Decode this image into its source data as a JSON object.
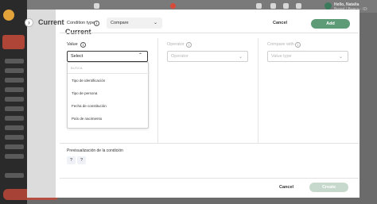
{
  "topbar": {
    "user_greeting": "Hello, Natalia",
    "user_sub": "Brand / Banco - ID: 2020/00123"
  },
  "page": {
    "title": "Current"
  },
  "condition": {
    "type_label": "Condition type",
    "type_value": "Compare",
    "cancel_label": "Cancel",
    "add_label": "Add"
  },
  "value_col": {
    "label": "Value",
    "placeholder": "Select",
    "search_placeholder": "BUSCA",
    "options": [
      "Tipo de identificación",
      "Tipo de persona",
      "Fecha de constitución",
      "País de nacimiento"
    ]
  },
  "operator_col": {
    "label": "Operator",
    "placeholder": "Operator"
  },
  "compare_col": {
    "label": "Compare with",
    "placeholder": "Value type"
  },
  "preview": {
    "label": "Previsualización de la condición",
    "chips": [
      "?",
      "?"
    ]
  },
  "footer": {
    "cancel_label": "Cancel",
    "create_label": "Create"
  },
  "colors": {
    "accent_green": "#5e9c78",
    "disabled_green": "#c7d9cc",
    "brand_red": "#c74a3a"
  }
}
